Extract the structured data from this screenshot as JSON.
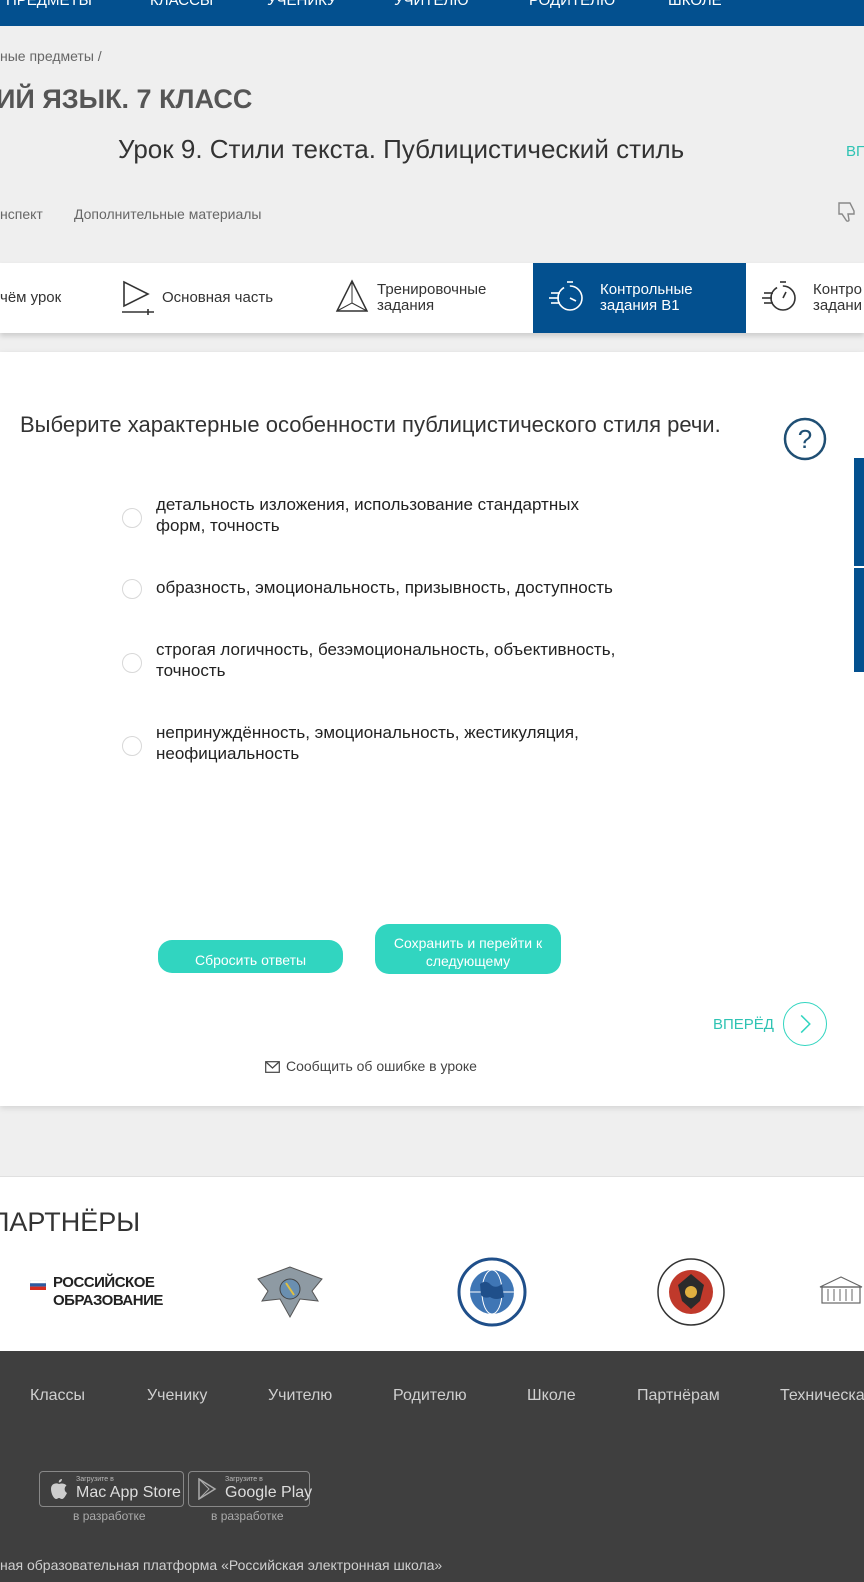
{
  "top_nav": [
    "ПРЕДМЕТЫ",
    "КЛАССЫ",
    "УЧЕНИКУ",
    "УЧИТЕЛЮ",
    "РОДИТЕЛЮ",
    "ШКОЛЕ"
  ],
  "breadcrumb": "ные предметы  /",
  "subject_title": "ИЙ ЯЗЫК. 7 КЛАСС",
  "lesson_title": "Урок 9. Стили текста. Публицистический стиль",
  "lesson_link": "ВП",
  "lesson_tabs": [
    "нспект",
    "Дополнительные материалы"
  ],
  "steps": [
    {
      "label": "чём урок"
    },
    {
      "label": "Основная часть"
    },
    {
      "label_1": "Тренировочные",
      "label_2": "задания"
    },
    {
      "label_1": "Контрольные",
      "label_2": "задания В1"
    },
    {
      "label_1": "Контро",
      "label_2": "задани"
    }
  ],
  "question": {
    "text": "Выберите характерные особенности публицистического стиля речи.",
    "help_symbol": "?",
    "options": [
      {
        "line1": "детальность изложения, использование стандартных",
        "line2": "форм, точность"
      },
      {
        "line1": "образность, эмоциональность, призывность, доступность",
        "line2": ""
      },
      {
        "line1": "строгая логичность, безэмоциональность, объективность,",
        "line2": "точность"
      },
      {
        "line1": "непринуждённость, эмоциональность, жестикуляция,",
        "line2": "неофициальность"
      }
    ]
  },
  "buttons": {
    "reset": "Сбросить ответы",
    "save_1": "Сохранить и перейти к",
    "save_2": "следующему"
  },
  "forward": "ВПЕРЁД",
  "report_error": "Сообщить об ошибке в уроке",
  "partners": {
    "title": "ПАРТНЁРЫ",
    "logo_text_1": "РОССИЙСКОЕ",
    "logo_text_2": "ОБРАЗОВАНИЕ"
  },
  "footer": {
    "nav": [
      "Классы",
      "Ученику",
      "Учителю",
      "Родителю",
      "Школе",
      "Партнёрам",
      "Техническая"
    ],
    "stores": [
      {
        "small": "Загрузите в",
        "name": "Mac App Store",
        "note": "в разработке"
      },
      {
        "small": "Загрузите в",
        "name": "Google Play",
        "note": "в разработке"
      }
    ],
    "copyright": "ная образовательная платформа «Российская электронная школа»"
  },
  "colors": {
    "primary": "#03508f",
    "accent": "#31d5c0",
    "footer": "#3f3f3f"
  }
}
